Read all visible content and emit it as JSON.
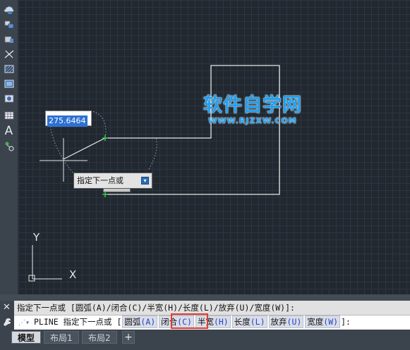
{
  "toolbar": {
    "items": [
      {
        "name": "revcloud-tool",
        "icon": "cloud-icon"
      },
      {
        "name": "insert-block-tool",
        "icon": "insert-block-icon"
      },
      {
        "name": "make-block-tool",
        "icon": "make-block-icon"
      },
      {
        "name": "line-tool",
        "icon": "line-icon"
      },
      {
        "name": "hatch-tool",
        "icon": "hatch-icon"
      },
      {
        "name": "gradient-tool",
        "icon": "gradient-icon"
      },
      {
        "name": "region-tool",
        "icon": "region-icon"
      },
      {
        "name": "table-tool",
        "icon": "table-icon"
      },
      {
        "name": "mtext-tool",
        "icon": "text-icon",
        "glyph": "A"
      },
      {
        "name": "add-selected-tool",
        "icon": "add-selected-icon"
      }
    ]
  },
  "drawing": {
    "dynamic_input_value": "275.6464",
    "tooltip_text": "指定下一点或",
    "watermark_title": "软件自学网",
    "watermark_url": "WWW.RJZXW.COM",
    "ucs_x_label": "X",
    "ucs_y_label": "Y",
    "line_color": "#e8e8e8",
    "snap_color": "#3bd34d"
  },
  "command": {
    "history_line": "指定下一点或 [圆弧(A)/闭合(C)/半宽(H)/长度(L)/放弃(U)/宽度(W)]:",
    "input_prefix": "PLINE 指定下一点或 [",
    "options": [
      {
        "label": "圆弧",
        "key": "(A)"
      },
      {
        "label": "闭合",
        "key": "(C)"
      },
      {
        "label": "半宽",
        "key": "(H)"
      },
      {
        "label": "长度",
        "key": "(L)"
      },
      {
        "label": "放弃",
        "key": "(U)"
      },
      {
        "label": "宽度",
        "key": "(W)"
      }
    ],
    "input_suffix": "]:",
    "close_glyph": "✕"
  },
  "tabs": {
    "items": [
      "模型",
      "布局1",
      "布局2"
    ],
    "active": "模型",
    "add_glyph": "+"
  },
  "colors": {
    "highlight": "#e23b2f",
    "option_key": "#2343c6"
  }
}
